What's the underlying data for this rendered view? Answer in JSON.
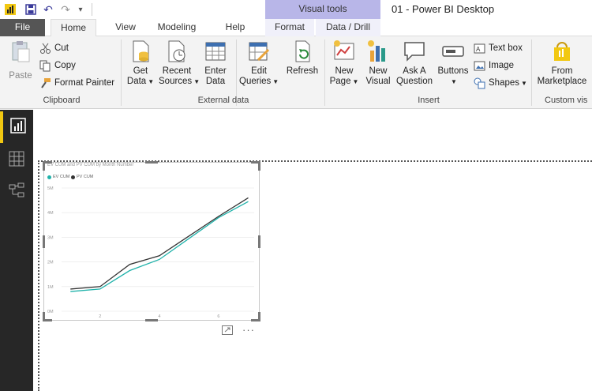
{
  "titlebar": {
    "doc_title": "01 - Power BI Desktop",
    "context_group": "Visual tools",
    "undo_label": "↶",
    "redo_label": "↷",
    "customize_label": "▾"
  },
  "tabs": [
    {
      "label": "File"
    },
    {
      "label": "Home"
    },
    {
      "label": "View"
    },
    {
      "label": "Modeling"
    },
    {
      "label": "Help"
    },
    {
      "label": "Format"
    },
    {
      "label": "Data / Drill"
    }
  ],
  "ribbon": {
    "clipboard": {
      "paste": "Paste",
      "cut": "Cut",
      "copy": "Copy",
      "format_painter": "Format Painter",
      "group_label": "Clipboard"
    },
    "external_data": {
      "get_data": [
        "Get",
        "Data"
      ],
      "recent_sources": [
        "Recent",
        "Sources"
      ],
      "enter_data": [
        "Enter",
        "Data"
      ],
      "edit_queries": [
        "Edit",
        "Queries"
      ],
      "refresh": "Refresh",
      "group_label": "External data"
    },
    "insert": {
      "new_page": [
        "New",
        "Page"
      ],
      "new_visual": [
        "New",
        "Visual"
      ],
      "ask_question": [
        "Ask A",
        "Question"
      ],
      "buttons": "Buttons",
      "text_box": "Text box",
      "image": "Image",
      "shapes": "Shapes",
      "group_label": "Insert"
    },
    "custom": {
      "from_marketplace": [
        "From",
        "Marketplace"
      ],
      "group_label": "Custom vis"
    }
  },
  "visual": {
    "title": "EV CUM and PV CUM by Month Number",
    "legend": [
      {
        "name": "EV CUM",
        "color": "#20b2aa"
      },
      {
        "name": "PV CUM",
        "color": "#333333"
      }
    ],
    "more_label": "···"
  },
  "chart_data": {
    "type": "line",
    "title": "EV CUM and PV CUM by Month Number",
    "x": [
      1,
      2,
      3,
      4,
      5,
      6,
      7
    ],
    "xticks": [
      "2",
      "4",
      "6"
    ],
    "yticks": [
      "0M",
      "1M",
      "2M",
      "3M",
      "4M",
      "5M"
    ],
    "ylim": [
      0,
      5
    ],
    "series": [
      {
        "name": "EV CUM",
        "color": "#20b2aa",
        "values": [
          0.8,
          0.9,
          1.65,
          2.1,
          2.95,
          3.8,
          4.45
        ]
      },
      {
        "name": "PV CUM",
        "color": "#333333",
        "values": [
          0.9,
          1.0,
          1.9,
          2.25,
          3.05,
          3.85,
          4.6
        ]
      }
    ]
  }
}
